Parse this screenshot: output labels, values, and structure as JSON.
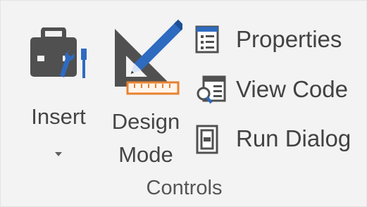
{
  "group": {
    "label": "Controls"
  },
  "buttons": {
    "insert": {
      "label": "Insert",
      "icon": "toolbox-icon",
      "has_dropdown": true
    },
    "design_mode": {
      "line1": "Design",
      "line2": "Mode",
      "icon": "design-mode-icon"
    },
    "properties": {
      "label": "Properties",
      "icon": "properties-icon"
    },
    "view_code": {
      "label": "View Code",
      "icon": "view-code-icon"
    },
    "run_dialog": {
      "label": "Run Dialog",
      "icon": "run-dialog-icon"
    }
  },
  "colors": {
    "background": "#f3f3f3",
    "text": "#444444",
    "icon_gray": "#505050",
    "accent_blue": "#2e6bc0",
    "ruler_orange": "#e8812e"
  }
}
